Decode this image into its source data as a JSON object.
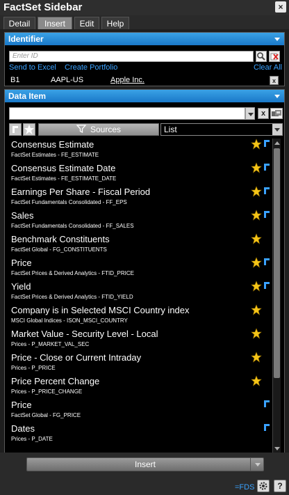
{
  "window": {
    "title": "FactSet Sidebar",
    "close_glyph": "×"
  },
  "tabs": [
    {
      "label": "Detail",
      "active": false
    },
    {
      "label": "Insert",
      "active": true
    },
    {
      "label": "Edit",
      "active": false
    },
    {
      "label": "Help",
      "active": false
    }
  ],
  "identifier": {
    "header": "Identifier",
    "input_placeholder": "Enter ID",
    "send_to_excel": "Send to Excel",
    "create_portfolio": "Create Portfolio",
    "clear_all": "Clear All",
    "row": {
      "cell": "B1",
      "ticker": "AAPL-US",
      "name": "Apple Inc.",
      "remove": "x"
    }
  },
  "data_item": {
    "header": "Data Item",
    "search_value": "",
    "clear_button": "x",
    "sources_label": "Sources",
    "view_select": "List",
    "items": [
      {
        "name": "Consensus Estimate",
        "sub": "FactSet Estimates - FE_ESTIMATE",
        "star": true,
        "fds": true
      },
      {
        "name": "Consensus Estimate Date",
        "sub": "FactSet Estimates - FE_ESTIMATE_DATE",
        "star": true,
        "fds": true
      },
      {
        "name": "Earnings Per Share - Fiscal Period",
        "sub": "FactSet Fundamentals Consolidated - FF_EPS",
        "star": true,
        "fds": true
      },
      {
        "name": "Sales",
        "sub": "FactSet Fundamentals Consolidated - FF_SALES",
        "star": true,
        "fds": true
      },
      {
        "name": "Benchmark Constituents",
        "sub": "FactSet Global - FG_CONSTITUENTS",
        "star": true,
        "fds": false
      },
      {
        "name": "Price",
        "sub": "FactSet Prices & Derived Analytics - FTID_PRICE",
        "star": true,
        "fds": true
      },
      {
        "name": "Yield",
        "sub": "FactSet Prices & Derived Analytics - FTID_YIELD",
        "star": true,
        "fds": true
      },
      {
        "name": "Company is in Selected MSCI Country index",
        "sub": "MSCI Global Indices - ISON_MSCI_COUNTRY",
        "star": true,
        "fds": false
      },
      {
        "name": "Market Value - Security Level - Local",
        "sub": "Prices - P_MARKET_VAL_SEC",
        "star": true,
        "fds": false
      },
      {
        "name": "Price - Close or Current Intraday",
        "sub": "Prices - P_PRICE",
        "star": true,
        "fds": false
      },
      {
        "name": "Price Percent Change",
        "sub": "Prices - P_PRICE_CHANGE",
        "star": true,
        "fds": false
      },
      {
        "name": "Price",
        "sub": "FactSet Global - FG_PRICE",
        "star": false,
        "fds": true
      },
      {
        "name": "Dates",
        "sub": "Prices - P_DATE",
        "star": false,
        "fds": true
      }
    ]
  },
  "insert_label": "Insert",
  "footer": {
    "fds_link": "=FDS",
    "settings_icon": "gear-icon",
    "help_label": "?"
  },
  "colors": {
    "header_blue": "#1a78c8",
    "link_blue": "#3aa2ff",
    "star_gold": "#f5c518"
  }
}
